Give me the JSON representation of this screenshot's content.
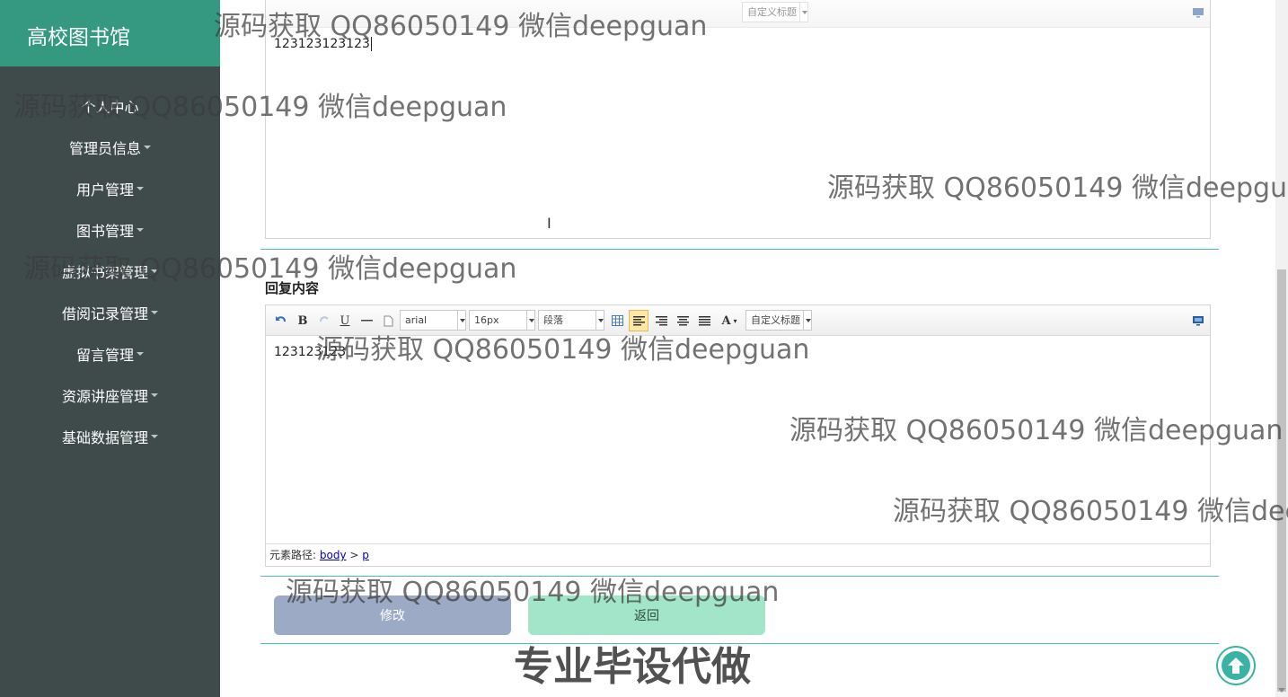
{
  "header": {
    "brand": "高校图书馆",
    "avatar_icon": "user-icon"
  },
  "sidebar": {
    "items": [
      {
        "label": "个人中心",
        "caret": false
      },
      {
        "label": "管理员信息",
        "caret": true
      },
      {
        "label": "用户管理",
        "caret": true
      },
      {
        "label": "图书管理",
        "caret": true
      },
      {
        "label": "虚拟书架管理",
        "caret": true
      },
      {
        "label": "借阅记录管理",
        "caret": true
      },
      {
        "label": "留言管理",
        "caret": true
      },
      {
        "label": "资源讲座管理",
        "caret": true
      },
      {
        "label": "基础数据管理",
        "caret": true
      }
    ]
  },
  "editor1": {
    "toolbar": {
      "custom_title": "自定义标题"
    },
    "content": "123123123123"
  },
  "reply": {
    "label": "回复内容",
    "toolbar": {
      "font_family": "arial",
      "font_size": "16px",
      "paragraph": "段落",
      "custom_title": "自定义标题",
      "bold": "B",
      "underline": "U",
      "font_color": "A"
    },
    "content": "123123123",
    "path_label": "元素路径:",
    "path_body": "body",
    "path_sep": ">",
    "path_p": "p"
  },
  "buttons": {
    "save": "修改",
    "back": "返回"
  },
  "watermarks": {
    "text": "源码获取 QQ86050149 微信deepguan",
    "text_cut_1": "源码获取 QQ86050149 微信deepgua",
    "text_cut_2": "源码获取 QQ86050149 微信dee",
    "bottom": "专业毕设代做"
  }
}
